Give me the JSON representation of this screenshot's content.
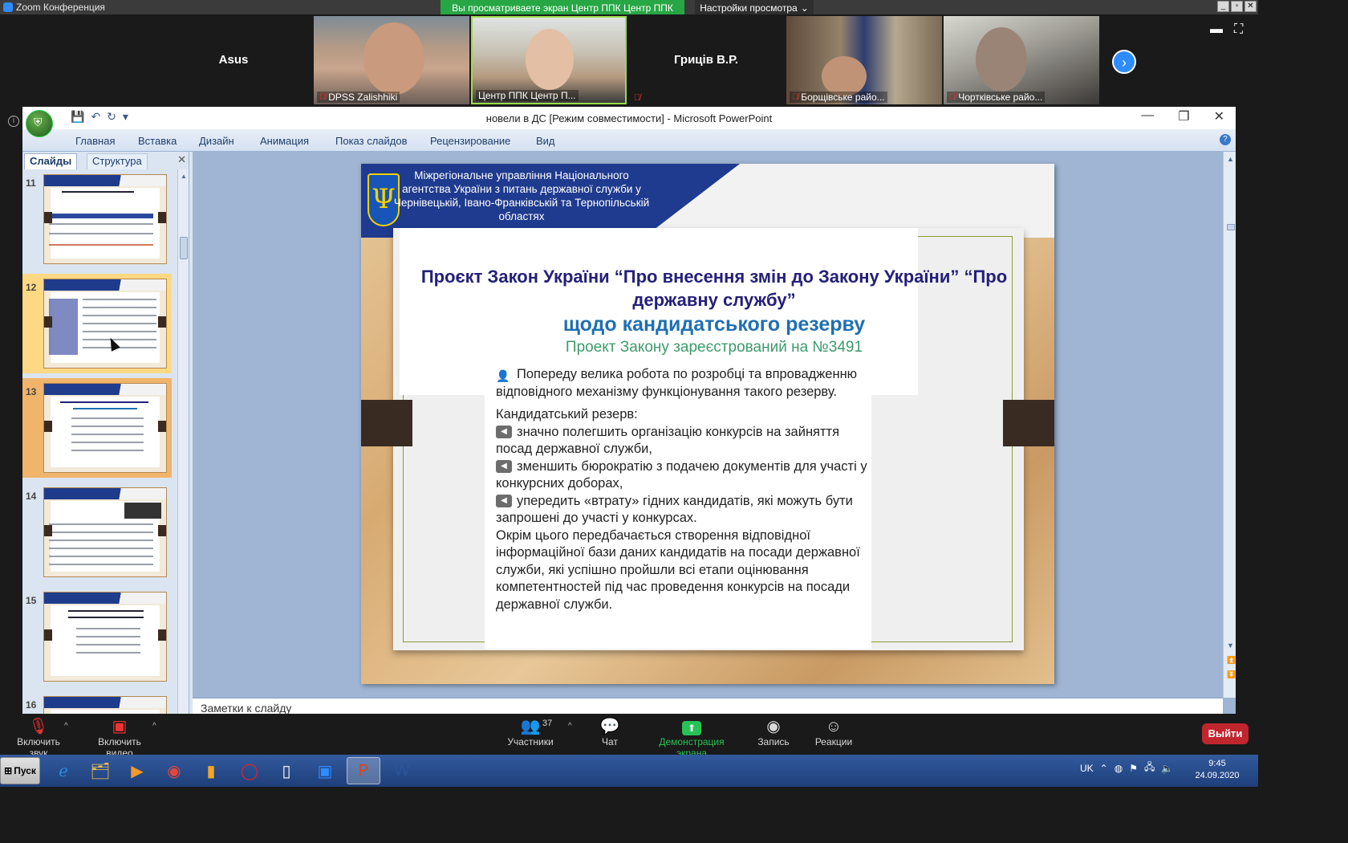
{
  "zoom": {
    "window_title": "Zoom Конференция",
    "share_banner": "Вы просматриваете экран Центр ППК Центр ППК",
    "view_options": "Настройки просмотра"
  },
  "participants": [
    {
      "name": "Asus",
      "video": false,
      "muted": false
    },
    {
      "name": "DPSS Zalishhiki",
      "video": true,
      "muted": true
    },
    {
      "name": "Центр ППК Центр П...",
      "video": true,
      "muted": false,
      "active_speaker": true
    },
    {
      "name": "Гриців В.Р.",
      "video": false,
      "muted": true
    },
    {
      "name": "Борщівське райо...",
      "video": true,
      "muted": true
    },
    {
      "name": "Чортківське райо...",
      "video": true,
      "muted": true
    }
  ],
  "ppt": {
    "title": "новели в ДС [Режим совместимости] - Microsoft PowerPoint",
    "ribbon_tabs": [
      "Главная",
      "Вставка",
      "Дизайн",
      "Анимация",
      "Показ слайдов",
      "Рецензирование",
      "Вид"
    ],
    "pane_tabs": {
      "slides": "Слайды",
      "outline": "Структура"
    },
    "thumbnails": [
      {
        "num": "11",
        "state": "normal"
      },
      {
        "num": "12",
        "state": "hover"
      },
      {
        "num": "13",
        "state": "selected"
      },
      {
        "num": "14",
        "state": "normal"
      },
      {
        "num": "15",
        "state": "normal"
      },
      {
        "num": "16",
        "state": "normal"
      }
    ],
    "notes_placeholder": "Заметки к слайду"
  },
  "slide": {
    "header": "Міжрегіональне управління Національного агентства України з питань державної служби  у Чернівецькій, Івано-Франківській та Тернопільській областях",
    "title": "Проєкт Закон України “Про внесення змін до Закону України” “Про державну службу”",
    "subtitle": "щодо  кандидатського резерву",
    "registration": "Проект Закону зареєстрований на №3491",
    "intro": "Попереду велика робота по розробці та впровадженню відповідного механізму функціонування такого резерву.",
    "reserve_label": "Кандидатський резерв:",
    "bullets": [
      "значно полегшить організацію конкурсів на зайняття посад державної служби,",
      "зменшить бюрократію з подачею документів для участі у конкурсних доборах,",
      "упередить «втрату» гідних кандидатів, які можуть бути запрошені до участі у конкурсах."
    ],
    "closing": "Окрім цього передбачається створення відповідної інформаційної бази даних кандидатів на посади державної служби, які успішно пройшли всі етапи оцінювання компетентностей під час проведення конкурсів на посади державної служби."
  },
  "toolbar": {
    "audio": "Включить звук",
    "video": "Включить видео",
    "participants": "Участники",
    "participants_count": "37",
    "chat": "Чат",
    "share": "Демонстрация экрана",
    "record": "Запись",
    "reactions": "Реакции",
    "leave": "Выйти"
  },
  "taskbar": {
    "start": "Пуск",
    "lang": "UK",
    "time": "9:45",
    "date": "24.09.2020"
  },
  "colors": {
    "share_green": "#27a744",
    "leave_red": "#c0262d",
    "slide_header_blue": "#1f3b8f",
    "title_navy": "#24207a",
    "subtitle_blue": "#1f6fb3",
    "registration_green": "#3d9b6a"
  }
}
